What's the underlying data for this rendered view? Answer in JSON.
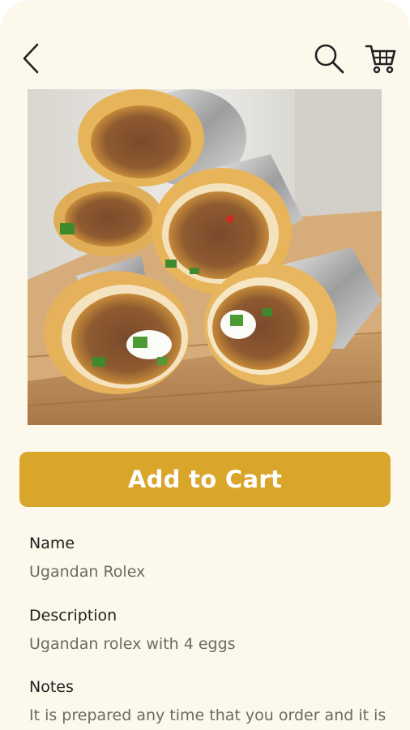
{
  "header": {
    "back_icon": "chevron-left-icon",
    "search_icon": "search-icon",
    "cart_icon": "shopping-cart-icon"
  },
  "product": {
    "image_alt": "Ugandan Rolex",
    "add_to_cart_label": "Add to Cart",
    "name_label": "Name",
    "name_value": "Ugandan Rolex",
    "description_label": "Description",
    "description_value": "Ugandan rolex with 4 eggs",
    "notes_label": "Notes",
    "notes_value": "It is prepared any time that you order and it is served when hot"
  },
  "colors": {
    "background": "#fdf8ec",
    "accent": "#d9a52a",
    "label_text": "#1f1f1f",
    "value_text": "#6d6a63"
  }
}
